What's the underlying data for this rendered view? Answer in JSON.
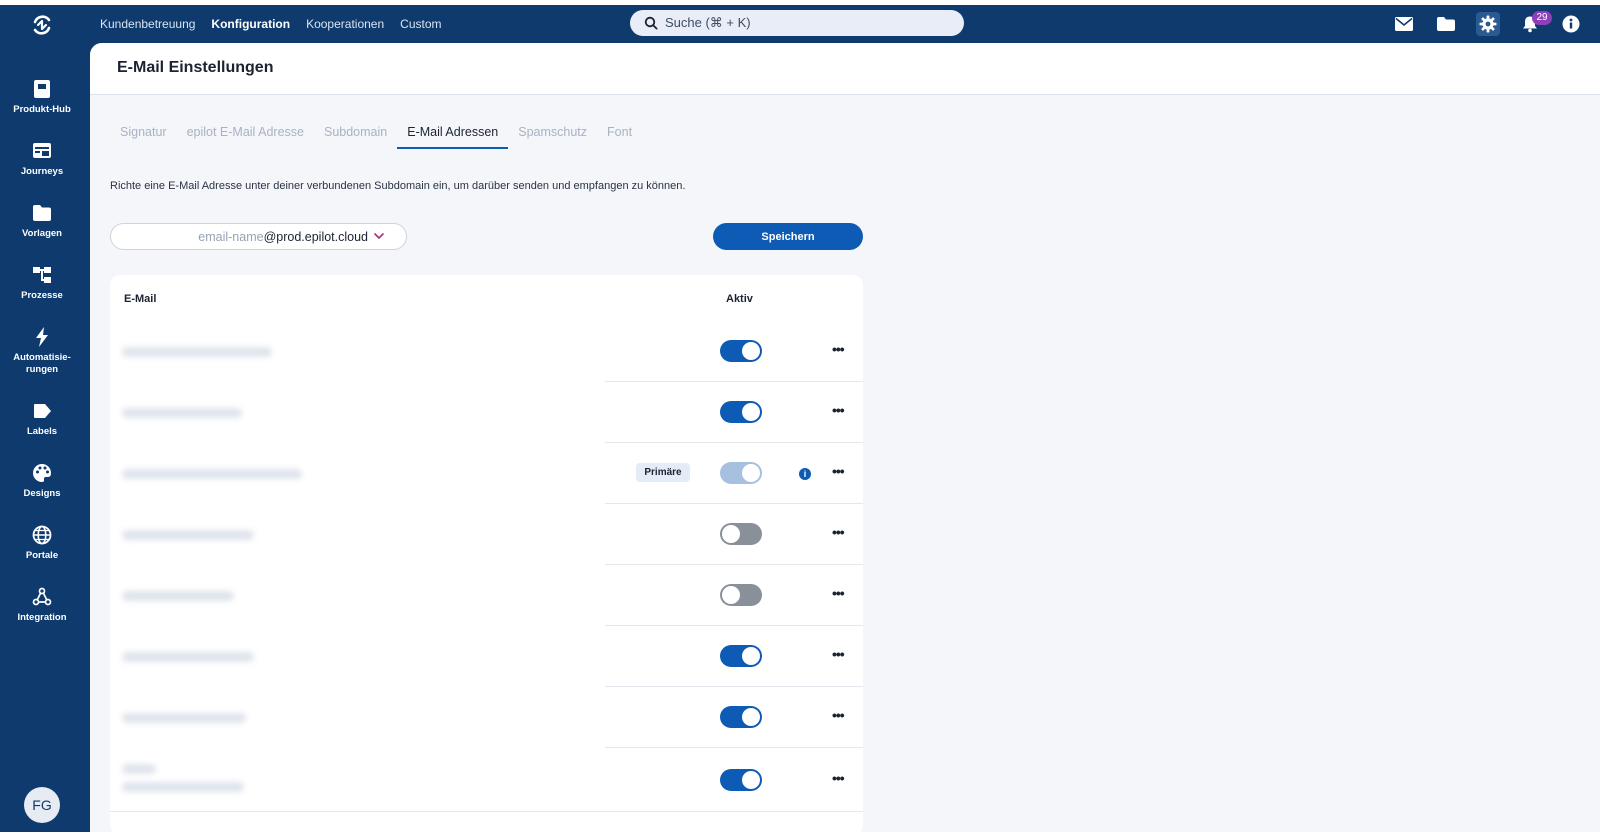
{
  "topbar": {
    "nav": [
      "Kundenbetreuung",
      "Konfiguration",
      "Kooperationen",
      "Custom"
    ],
    "active_nav": "Konfiguration",
    "search_placeholder": "Suche (⌘ + K)",
    "notification_count": "29"
  },
  "sidebar": {
    "items": [
      {
        "label": "Produkt-Hub",
        "icon": "box-icon"
      },
      {
        "label": "Journeys",
        "icon": "browser-icon"
      },
      {
        "label": "Vorlagen",
        "icon": "folder-icon"
      },
      {
        "label": "Prozesse",
        "icon": "flow-icon"
      },
      {
        "label": "Automatisie-\nrungen",
        "icon": "bolt-icon"
      },
      {
        "label": "Labels",
        "icon": "tag-icon"
      },
      {
        "label": "Designs",
        "icon": "palette-icon"
      },
      {
        "label": "Portale",
        "icon": "globe-icon"
      },
      {
        "label": "Integration",
        "icon": "webhook-icon"
      }
    ],
    "avatar_initials": "FG"
  },
  "page": {
    "title": "E-Mail Einstellungen",
    "tabs": [
      "Signatur",
      "epilot E-Mail Adresse",
      "Subdomain",
      "E-Mail Adressen",
      "Spamschutz",
      "Font"
    ],
    "active_tab": "E-Mail Adressen",
    "description": "Richte eine E-Mail Adresse unter deiner verbundenen Subdomain ein, um darüber senden und empfangen zu können.",
    "email_placeholder": "email-name",
    "email_domain": "@prod.epilot.cloud",
    "save_label": "Speichern"
  },
  "table": {
    "headers": {
      "email": "E-Mail",
      "active": "Aktiv"
    },
    "primary_label": "Primäre",
    "rows": [
      {
        "active": true
      },
      {
        "active": true
      },
      {
        "active": true,
        "primary": true
      },
      {
        "active": false
      },
      {
        "active": false
      },
      {
        "active": true
      },
      {
        "active": true
      },
      {
        "active": true
      }
    ]
  }
}
